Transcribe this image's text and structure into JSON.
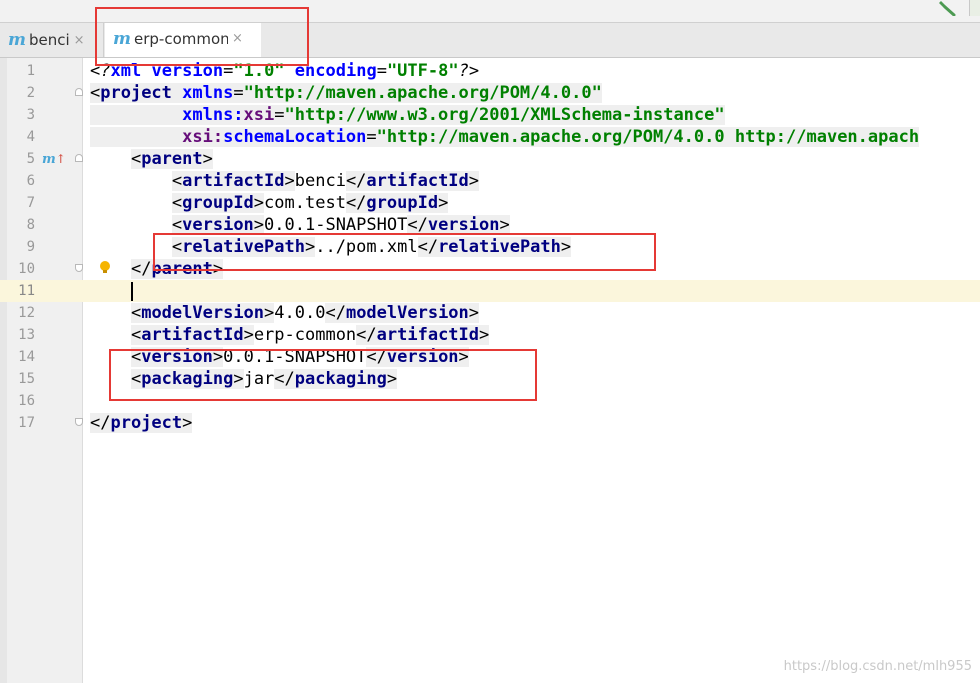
{
  "tabs": [
    {
      "label": "benci",
      "icon": "maven-m-icon",
      "active": false
    },
    {
      "label": "erp-common",
      "icon": "maven-m-icon",
      "active": true
    }
  ],
  "close_glyph": "×",
  "maven_glyph": "m",
  "watermark": "https://blog.csdn.net/mlh955",
  "lines": [
    {
      "n": "1"
    },
    {
      "n": "2"
    },
    {
      "n": "3"
    },
    {
      "n": "4"
    },
    {
      "n": "5"
    },
    {
      "n": "6"
    },
    {
      "n": "7"
    },
    {
      "n": "8"
    },
    {
      "n": "9"
    },
    {
      "n": "10"
    },
    {
      "n": "11"
    },
    {
      "n": "12"
    },
    {
      "n": "13"
    },
    {
      "n": "14"
    },
    {
      "n": "15"
    },
    {
      "n": "16"
    },
    {
      "n": "17"
    }
  ],
  "xml": {
    "decl_open": "<?",
    "decl_name": "xml",
    "version_attr": "version",
    "version_val": "\"1.0\"",
    "encoding_attr": "encoding",
    "encoding_val": "\"UTF-8\"",
    "decl_close": "?>",
    "project": "project",
    "xmlns_attr": "xmlns",
    "xmlns_val": "\"http://maven.apache.org/POM/4.0.0\"",
    "xsi_prefix": "xmlns:",
    "xsi_name": "xsi",
    "xsi_val": "\"http://www.w3.org/2001/XMLSchema-instance\"",
    "schema_prefix": "xsi:",
    "schema_name": "schemaLocation",
    "schema_val": "\"http://maven.apache.org/POM/4.0.0 http://maven.apach",
    "parent": "parent",
    "artifactId": "artifactId",
    "parent_artifact": "benci",
    "groupId": "groupId",
    "group_val": "com.test",
    "version": "version",
    "parent_version": "0.0.1-SNAPSHOT",
    "relativePath": "relativePath",
    "relative_val": "../pom.xml",
    "modelVersion": "modelVersion",
    "model_val": "4.0.0",
    "artifact_val": "erp-common",
    "version_val2": "0.0.1-SNAPSHOT",
    "packaging": "packaging",
    "packaging_val": "jar"
  },
  "colors": {
    "tag": "#000080",
    "attribute": "#0000ff",
    "namespace": "#660e7a",
    "string": "#008000",
    "annotation_box": "#e53935",
    "current_line": "#fbf6dc"
  }
}
